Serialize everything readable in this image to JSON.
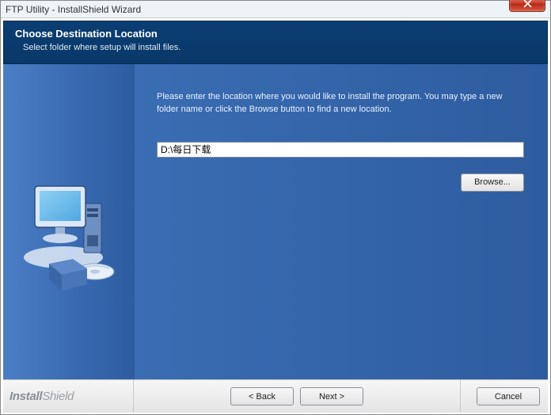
{
  "window": {
    "title": "FTP Utility - InstallShield Wizard"
  },
  "header": {
    "title": "Choose Destination Location",
    "subtitle": "Select folder where setup will install files."
  },
  "content": {
    "instruction": "Please enter the location where you would like to install the program.  You may type a new folder name or click the Browse button to find a new location.",
    "path_value": "D:\\每日下载",
    "browse_label": "Browse..."
  },
  "footer": {
    "brand_prefix": "Install",
    "brand_suffix": "Shield",
    "back_label": "< Back",
    "next_label": "Next >",
    "cancel_label": "Cancel"
  }
}
